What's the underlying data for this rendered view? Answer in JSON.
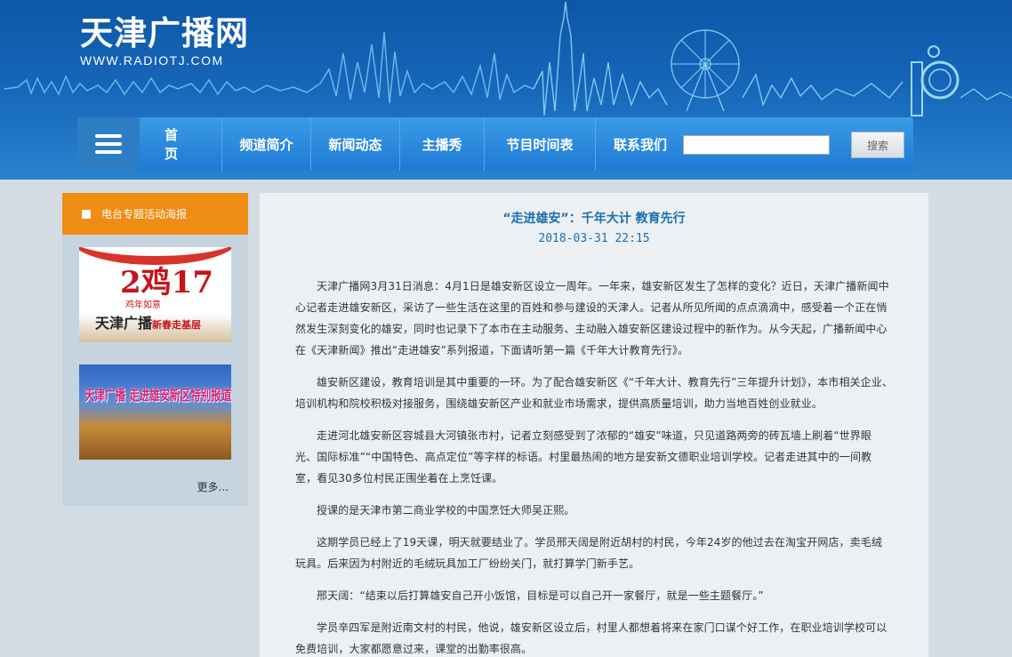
{
  "header": {
    "logo_title": "天津广播网",
    "logo_url": "WWW.RADIOTJ.COM"
  },
  "nav": {
    "items": [
      {
        "label": "首页"
      },
      {
        "label": "频道简介"
      },
      {
        "label": "新闻动态"
      },
      {
        "label": "主播秀"
      },
      {
        "label": "节目时间表"
      }
    ],
    "contact_label": "联系我们",
    "search_value": "",
    "search_button": "搜索"
  },
  "sidebar": {
    "title": "电台专题活动海报",
    "banner1": {
      "year": "2鸡17",
      "sub": "鸡年如意",
      "main": "天津广播",
      "main_sub": "新春走基层"
    },
    "banner2": {
      "text": "天津广播 走进雄安新区特别报道"
    },
    "more": "更多..."
  },
  "article": {
    "title": "“走进雄安”：千年大计 教育先行",
    "date": "2018-03-31 22:15",
    "paragraphs": [
      "天津广播网3月31日消息：4月1日是雄安新区设立一周年。一年来，雄安新区发生了怎样的变化？近日，天津广播新闻中心记者走进雄安新区，采访了一些生活在这里的百姓和参与建设的天津人。记者从所见所闻的点点滴滴中，感受着一个正在悄然发生深刻变化的雄安，同时也记录下了本市在主动服务、主动融入雄安新区建设过程中的新作为。从今天起，广播新闻中心在《天津新闻》推出“走进雄安”系列报道，下面请听第一篇《千年大计教育先行》。",
      "雄安新区建设，教育培训是其中重要的一环。为了配合雄安新区《“千年大计、教育先行”三年提升计划》，本市相关企业、培训机构和院校积极对接服务，围绕雄安新区产业和就业市场需求，提供高质量培训，助力当地百姓创业就业。",
      "走进河北雄安新区容城县大河镇张市村，记者立刻感受到了浓郁的“雄安”味道，只见道路两旁的砖瓦墙上刷着“世界眼光、国际标准”“中国特色、高点定位”等字样的标语。村里最热闹的地方是安新文德职业培训学校。记者走进其中的一间教室，看见30多位村民正围坐着在上烹饪课。",
      "授课的是天津市第二商业学校的中国烹饪大师吴正熙。",
      "这期学员已经上了19天课，明天就要结业了。学员邢天阔是附近胡村的村民，今年24岁的他过去在淘宝开网店，卖毛绒玩具。后来因为村附近的毛绒玩具加工厂纷纷关门，就打算学门新手艺。",
      "邢天阔：“结束以后打算雄安自己开小饭馆，目标是可以自己开一家餐厅，就是一些主题餐厅。”",
      "学员辛四军是附近南文村的村民，他说，雄安新区设立后，村里人都想着将来在家门口谋个好工作，在职业培训学校可以免费培训，大家都愿意过来，课堂的出勤率很高。"
    ]
  }
}
